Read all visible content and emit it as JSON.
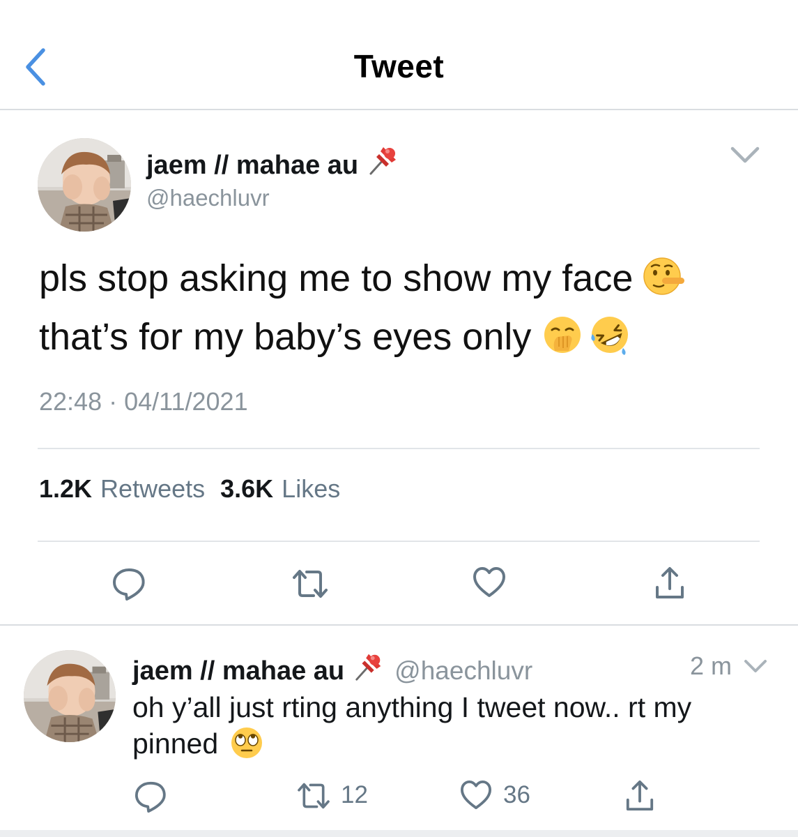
{
  "header": {
    "title": "Tweet"
  },
  "tweet": {
    "display_name": "jaem // mahae au",
    "handle": "@haechluvr",
    "text_line1": "pls stop asking me to show my face",
    "text_line2": "that’s for my baby’s eyes only",
    "time": "22:48",
    "separator": "·",
    "date": "04/11/2021",
    "retweets_count": "1.2K",
    "retweets_label": "Retweets",
    "likes_count": "3.6K",
    "likes_label": "Likes",
    "emojis": [
      "lying-face-emoji",
      "hand-over-mouth-emoji",
      "rolling-on-floor-laughing-emoji"
    ]
  },
  "reply": {
    "display_name": "jaem // mahae au",
    "handle": "@haechluvr",
    "time_ago": "2 m",
    "text": "oh y’all just rting anything I tweet now.. rt my pinned",
    "retweet_count": "12",
    "like_count": "36",
    "emoji": "eye-roll-emoji"
  },
  "colors": {
    "accent_blue": "#4a90e2",
    "muted_text": "#8a949c",
    "icon_gray": "#657786",
    "divider": "#e1e5e8"
  },
  "icons": {
    "back": "chevron-left-icon",
    "caret": "chevron-down-icon",
    "pin": "pushpin-icon",
    "reply": "speech-bubble-icon",
    "retweet": "retweet-arrows-icon",
    "like": "heart-icon",
    "share": "share-up-arrow-icon"
  }
}
